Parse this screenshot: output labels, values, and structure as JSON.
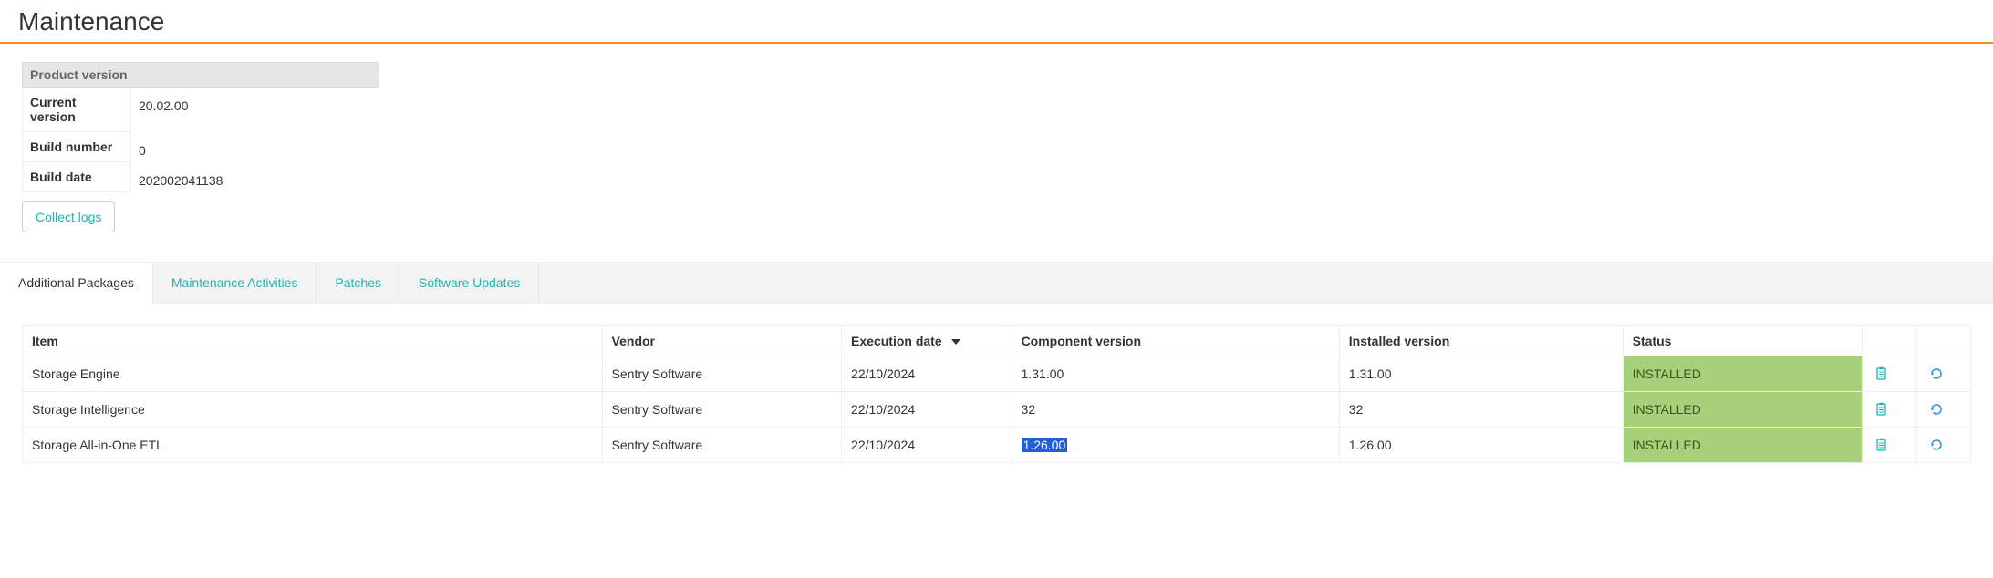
{
  "page": {
    "title": "Maintenance"
  },
  "product_version": {
    "header": "Product version",
    "rows": [
      {
        "label": "Current version",
        "value": "20.02.00"
      },
      {
        "label": "Build number",
        "value": "0"
      },
      {
        "label": "Build date",
        "value": "202002041138"
      }
    ]
  },
  "buttons": {
    "collect_logs": "Collect logs"
  },
  "tabs": {
    "items": [
      {
        "label": "Additional Packages",
        "active": true
      },
      {
        "label": "Maintenance Activities",
        "active": false
      },
      {
        "label": "Patches",
        "active": false
      },
      {
        "label": "Software Updates",
        "active": false
      }
    ]
  },
  "table": {
    "headers": {
      "item": "Item",
      "vendor": "Vendor",
      "execution_date": "Execution date",
      "component_version": "Component version",
      "installed_version": "Installed version",
      "status": "Status"
    },
    "rows": [
      {
        "item": "Storage Engine",
        "vendor": "Sentry Software",
        "execution_date": "22/10/2024",
        "component_version": "1.31.00",
        "installed_version": "1.31.00",
        "status": "INSTALLED",
        "selected": false
      },
      {
        "item": "Storage Intelligence",
        "vendor": "Sentry Software",
        "execution_date": "22/10/2024",
        "component_version": "32",
        "installed_version": "32",
        "status": "INSTALLED",
        "selected": false
      },
      {
        "item": "Storage All-in-One ETL",
        "vendor": "Sentry Software",
        "execution_date": "22/10/2024",
        "component_version": "1.26.00",
        "installed_version": "1.26.00",
        "status": "INSTALLED",
        "selected": true
      }
    ]
  },
  "icons": {
    "clipboard": "clipboard-icon",
    "refresh": "refresh-icon"
  }
}
